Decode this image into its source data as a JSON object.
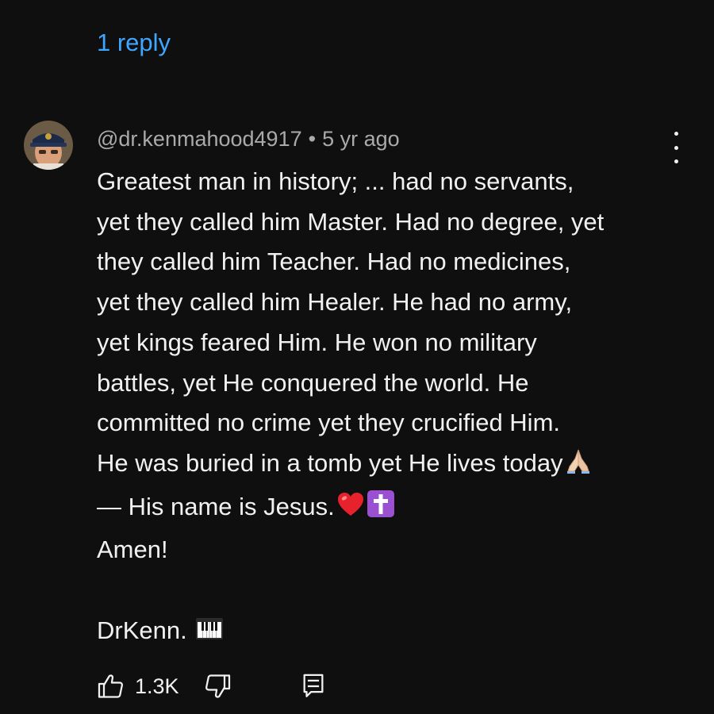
{
  "thread": {
    "replies_label": "1 reply"
  },
  "comment": {
    "author_handle": "@dr.kenmahood4917",
    "separator": "•",
    "timestamp": "5 yr ago",
    "lines": [
      "Greatest man in history; ... had no servants,",
      "yet they called him Master. Had no degree, yet",
      "they called him Teacher. Had no medicines,",
      "yet they called him Healer. He had no army,",
      "yet kings feared Him. He won no military",
      "battles, yet He conquered the world. He",
      "committed no crime yet they crucified Him.",
      "He was buried in a tomb yet He lives today",
      "— His name is Jesus.",
      "Amen!",
      "DrKenn."
    ],
    "emojis": {
      "praying_hands": "folded-hands-emoji",
      "heart": "red-heart-emoji",
      "cross": "latin-cross-emoji",
      "keyboard": "musical-keyboard-emoji"
    },
    "like_count": "1.3K"
  },
  "colors": {
    "background": "#0f0f0f",
    "link": "#3ea6ff",
    "text": "#f1f1f1",
    "secondary_text": "#aaaaaa"
  },
  "icons": {
    "like": "thumbs-up-icon",
    "dislike": "thumbs-down-icon",
    "reply": "reply-comment-icon",
    "menu": "more-vert-icon"
  }
}
